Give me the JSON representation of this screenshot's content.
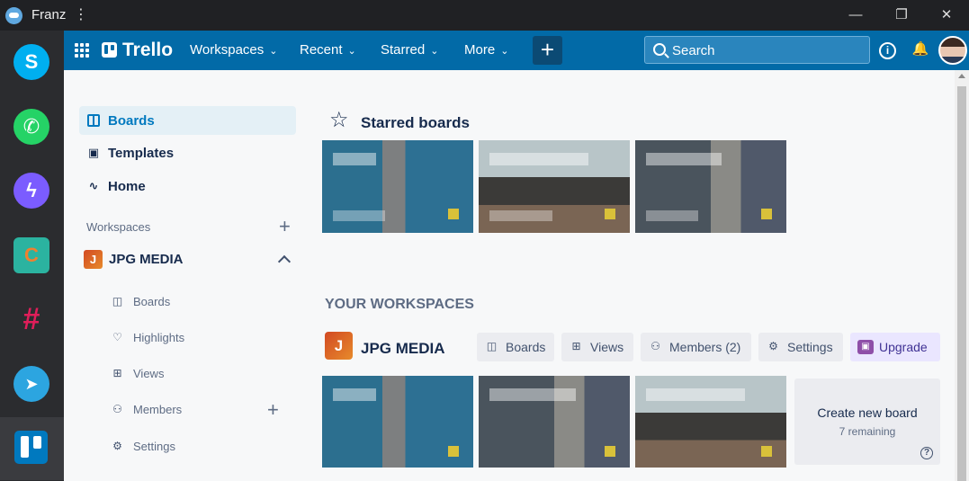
{
  "franz": {
    "title": "Franz",
    "menu_glyph": "⋮",
    "window_controls": {
      "minimize": "—",
      "maximize": "❐",
      "close": "✕"
    },
    "services": [
      {
        "name": "skype",
        "glyph": "S",
        "color": "#00aff0"
      },
      {
        "name": "whatsapp",
        "glyph": "✆",
        "color": "#25d366"
      },
      {
        "name": "messenger",
        "glyph": "ϟ",
        "color": "#7b5cff"
      },
      {
        "name": "custom",
        "glyph": "C",
        "color": "#2bb3a0"
      },
      {
        "name": "slack",
        "glyph": "#",
        "color": "#e01e5a"
      },
      {
        "name": "telegram",
        "glyph": "➤",
        "color": "#2ca5e0"
      },
      {
        "name": "trello",
        "glyph": "▮▮",
        "color": "#0079bf"
      }
    ]
  },
  "header": {
    "brand": "Trello",
    "nav": [
      {
        "label": "Workspaces",
        "chevron": "⌄"
      },
      {
        "label": "Recent",
        "chevron": "⌄"
      },
      {
        "label": "Starred",
        "chevron": "⌄"
      },
      {
        "label": "More",
        "chevron": "⌄"
      }
    ],
    "create_glyph": "+",
    "search": {
      "placeholder": "Search"
    },
    "info_glyph": "i",
    "bell_glyph": "🔔",
    "colors": {
      "bar": "#026aa7",
      "create": "#0b4a74"
    }
  },
  "sidebar": {
    "links": [
      {
        "label": "Boards",
        "icon": "board-icon",
        "active": true
      },
      {
        "label": "Templates",
        "icon": "template-icon",
        "glyph": "▣"
      },
      {
        "label": "Home",
        "icon": "pulse-icon",
        "glyph": "∿"
      }
    ],
    "workspaces_heading": "Workspaces",
    "add_glyph": "+",
    "workspace": {
      "initial": "J",
      "name": "JPG MEDIA",
      "items": [
        {
          "label": "Boards",
          "icon": "board-icon",
          "glyph": "◫"
        },
        {
          "label": "Highlights",
          "icon": "heart-icon",
          "glyph": "♡"
        },
        {
          "label": "Views",
          "icon": "grid-icon",
          "glyph": "⊞"
        },
        {
          "label": "Members",
          "icon": "members-icon",
          "glyph": "⚇"
        },
        {
          "label": "Settings",
          "icon": "gear-icon",
          "glyph": "⚙"
        }
      ]
    }
  },
  "main": {
    "starred_title": "Starred boards",
    "star_glyph": "☆",
    "starred_boards": [
      {
        "style": "tower"
      },
      {
        "style": "mount"
      },
      {
        "style": "rock"
      }
    ],
    "your_workspaces_title": "YOUR WORKSPACES",
    "workspace": {
      "initial": "J",
      "name": "JPG MEDIA",
      "buttons": [
        {
          "label": "Boards",
          "glyph": "◫"
        },
        {
          "label": "Views",
          "glyph": "⊞"
        },
        {
          "label": "Members (2)",
          "glyph": "⚇"
        },
        {
          "label": "Settings",
          "glyph": "⚙"
        },
        {
          "label": "Upgrade",
          "glyph": "▣"
        }
      ],
      "boards": [
        {
          "style": "tower"
        },
        {
          "style": "rock"
        },
        {
          "style": "mount"
        }
      ],
      "create_board": {
        "title": "Create new board",
        "remaining": "7 remaining",
        "help_glyph": "?"
      }
    }
  }
}
